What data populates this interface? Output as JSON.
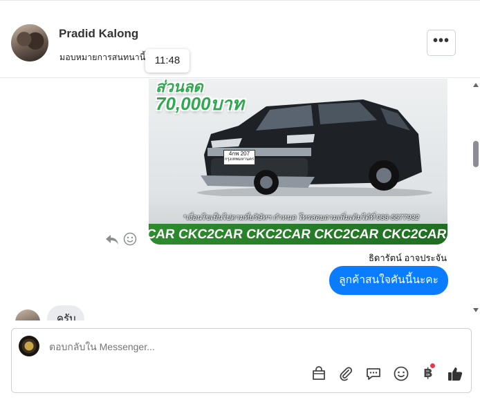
{
  "header": {
    "contact_name": "Pradid Kalong",
    "contact_sub": "มอบหมายการสนทนานี้",
    "timestamp_tooltip": "11:48",
    "more_label": "•••"
  },
  "message_image": {
    "promo_prefix": "ส่วนลด",
    "promo_amount": "70,000บาท",
    "plate_line1": "4กพ 207",
    "plate_line2": "กรุงเทพมหานคร",
    "caption": "*เงื่อนไขเป็นไปตามที่บริษัทฯ กำหนด โทรสอบถามเพิ่มเติมได้ที่ 088-5577932",
    "band_text": "2CAR CKC2CAR CKC2CAR CKC2CAR CKC2CAR CKC2"
  },
  "outgoing": {
    "sender_name": "ธิดารัตน์ อาจประจัน",
    "text": "ลูกค้าสนใจคันนี้นะคะ"
  },
  "incoming": {
    "text": "ครับ"
  },
  "composer": {
    "placeholder": "ตอบกลับใน Messenger...",
    "baht_symbol": "฿"
  },
  "colors": {
    "accent_blue": "#0a7cff",
    "notification_red": "#e53950",
    "promo_green": "#2fa84f"
  }
}
